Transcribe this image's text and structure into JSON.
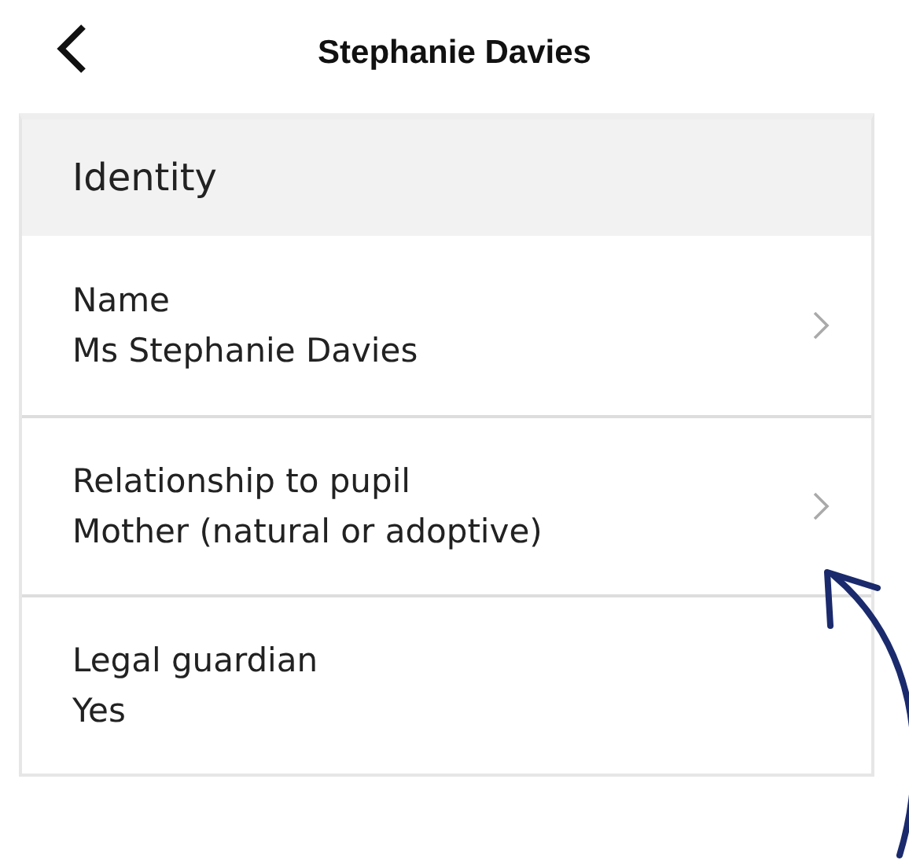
{
  "header": {
    "title": "Stephanie Davies"
  },
  "section": {
    "title": "Identity"
  },
  "rows": [
    {
      "label": "Name",
      "value": "Ms Stephanie Davies",
      "navigable": true
    },
    {
      "label": "Relationship to pupil",
      "value": "Mother (natural or adoptive)",
      "navigable": true
    },
    {
      "label": "Legal guardian",
      "value": "Yes",
      "navigable": false
    }
  ]
}
